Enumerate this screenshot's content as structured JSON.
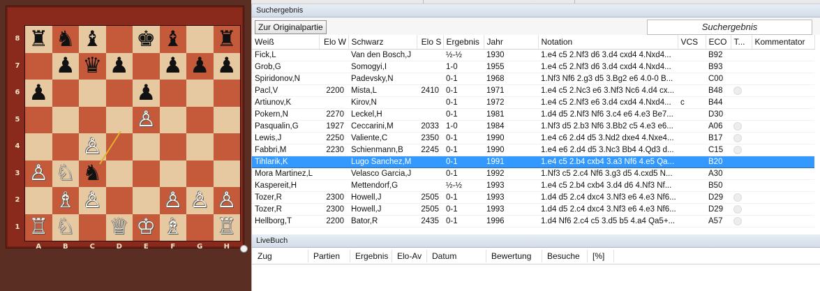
{
  "board": {
    "ranks": [
      "8",
      "7",
      "6",
      "5",
      "4",
      "3",
      "2",
      "1"
    ],
    "files": [
      "A",
      "B",
      "C",
      "D",
      "E",
      "F",
      "G",
      "H"
    ],
    "position": [
      [
        "bR",
        "bN",
        "bB",
        "",
        "bK",
        "bB",
        "",
        "bR"
      ],
      [
        "",
        "bP",
        "bQ",
        "bP",
        "",
        "bP",
        "bP",
        "bP"
      ],
      [
        "bP",
        "",
        "",
        "",
        "bP",
        "",
        "",
        ""
      ],
      [
        "",
        "",
        "",
        "",
        "wP",
        "",
        "",
        ""
      ],
      [
        "",
        "",
        "wP",
        "",
        "",
        "",
        "",
        ""
      ],
      [
        "wP",
        "wN",
        "bN",
        "",
        "",
        "",
        "",
        ""
      ],
      [
        "",
        "wB",
        "wP",
        "",
        "",
        "wP",
        "wP",
        "wP"
      ],
      [
        "wR",
        "wN",
        "",
        "wQ",
        "wK",
        "wB",
        "",
        "wR"
      ]
    ],
    "pieces": {
      "wK": "♔",
      "wQ": "♕",
      "wR": "♖",
      "wB": "♗",
      "wN": "♘",
      "wP": "♙",
      "bK": "♚",
      "bQ": "♛",
      "bR": "♜",
      "bB": "♝",
      "bN": "♞",
      "bP": "♟"
    },
    "last_move": "b4-c3"
  },
  "results_panel": {
    "header": "Suchergebnis",
    "original_button": "Zur Originalpartie",
    "title_box": "Suchergebnis",
    "columns": [
      "Weiß",
      "Elo W",
      "Schwarz",
      "Elo S",
      "Ergebnis",
      "Jahr",
      "Notation",
      "VCS",
      "ECO",
      "T...",
      "Kommentator"
    ],
    "rows": [
      {
        "white": "Fick,L",
        "elo_w": "",
        "black": "Van den Bosch,J",
        "elo_s": "",
        "result": "½-½",
        "year": "1930",
        "notation": "1.e4 c5 2.Nf3 d6 3.d4 cxd4 4.Nxd4...",
        "vcs": "",
        "eco": "B92",
        "t": ""
      },
      {
        "white": "Grob,G",
        "elo_w": "",
        "black": "Somogyi,I",
        "elo_s": "",
        "result": "1-0",
        "year": "1955",
        "notation": "1.e4 c5 2.Nf3 d6 3.d4 cxd4 4.Nxd4...",
        "vcs": "",
        "eco": "B93",
        "t": ""
      },
      {
        "white": "Spiridonov,N",
        "elo_w": "",
        "black": "Padevsky,N",
        "elo_s": "",
        "result": "0-1",
        "year": "1968",
        "notation": "1.Nf3 Nf6 2.g3 d5 3.Bg2 e6 4.0-0 B...",
        "vcs": "",
        "eco": "C00",
        "t": ""
      },
      {
        "white": "Pacl,V",
        "elo_w": "2200",
        "black": "Mista,L",
        "elo_s": "2410",
        "result": "0-1",
        "year": "1971",
        "notation": "1.e4 c5 2.Nc3 e6 3.Nf3 Nc6 4.d4 cx...",
        "vcs": "",
        "eco": "B48",
        "t": "dot"
      },
      {
        "white": "Artiunov,K",
        "elo_w": "",
        "black": "Kirov,N",
        "elo_s": "",
        "result": "0-1",
        "year": "1972",
        "notation": "1.e4 c5 2.Nf3 e6 3.d4 cxd4 4.Nxd4...",
        "vcs": "c",
        "eco": "B44",
        "t": ""
      },
      {
        "white": "Pokern,N",
        "elo_w": "2270",
        "black": "Leckel,H",
        "elo_s": "",
        "result": "0-1",
        "year": "1981",
        "notation": "1.d4 d5 2.Nf3 Nf6 3.c4 e6 4.e3 Be7...",
        "vcs": "",
        "eco": "D30",
        "t": ""
      },
      {
        "white": "Pasqualin,G",
        "elo_w": "1927",
        "black": "Ceccarini,M",
        "elo_s": "2033",
        "result": "1-0",
        "year": "1984",
        "notation": "1.Nf3 d5 2.b3 Nf6 3.Bb2 c5 4.e3 e6...",
        "vcs": "",
        "eco": "A06",
        "t": "dot"
      },
      {
        "white": "Lewis,J",
        "elo_w": "2250",
        "black": "Valiente,C",
        "elo_s": "2350",
        "result": "0-1",
        "year": "1990",
        "notation": "1.e4 c6 2.d4 d5 3.Nd2 dxe4 4.Nxe4...",
        "vcs": "",
        "eco": "B17",
        "t": "dot"
      },
      {
        "white": "Fabbri,M",
        "elo_w": "2230",
        "black": "Schienmann,B",
        "elo_s": "2245",
        "result": "0-1",
        "year": "1990",
        "notation": "1.e4 e6 2.d4 d5 3.Nc3 Bb4 4.Qd3 d...",
        "vcs": "",
        "eco": "C15",
        "t": "dot"
      },
      {
        "white": "Tihlarik,K",
        "elo_w": "",
        "black": "Lugo Sanchez,M",
        "elo_s": "",
        "result": "0-1",
        "year": "1991",
        "notation": "1.e4 c5 2.b4 cxb4 3.a3 Nf6 4.e5 Qa...",
        "vcs": "",
        "eco": "B20",
        "t": "",
        "selected": true
      },
      {
        "white": "Mora Martinez,L",
        "elo_w": "",
        "black": "Velasco Garcia,J",
        "elo_s": "",
        "result": "0-1",
        "year": "1992",
        "notation": "1.Nf3 c5 2.c4 Nf6 3.g3 d5 4.cxd5 N...",
        "vcs": "",
        "eco": "A30",
        "t": ""
      },
      {
        "white": "Kaspereit,H",
        "elo_w": "",
        "black": "Mettendorf,G",
        "elo_s": "",
        "result": "½-½",
        "year": "1993",
        "notation": "1.e4 c5 2.b4 cxb4 3.d4 d6 4.Nf3 Nf...",
        "vcs": "",
        "eco": "B50",
        "t": ""
      },
      {
        "white": "Tozer,R",
        "elo_w": "2300",
        "black": "Howell,J",
        "elo_s": "2505",
        "result": "0-1",
        "year": "1993",
        "notation": "1.d4 d5 2.c4 dxc4 3.Nf3 e6 4.e3 Nf6...",
        "vcs": "",
        "eco": "D29",
        "t": "dot"
      },
      {
        "white": "Tozer,R",
        "elo_w": "2300",
        "black": "Howell,J",
        "elo_s": "2505",
        "result": "0-1",
        "year": "1993",
        "notation": "1.d4 d5 2.c4 dxc4 3.Nf3 e6 4.e3 Nf6...",
        "vcs": "",
        "eco": "D29",
        "t": "dot"
      },
      {
        "white": "Hellborg,T",
        "elo_w": "2200",
        "black": "Bator,R",
        "elo_s": "2435",
        "result": "0-1",
        "year": "1996",
        "notation": "1.d4 Nf6 2.c4 c5 3.d5 b5 4.a4 Qa5+...",
        "vcs": "",
        "eco": "A57",
        "t": "dot"
      }
    ]
  },
  "livebook": {
    "header": "LiveBuch",
    "columns": [
      "Zug",
      "Partien",
      "Ergebnis",
      "Elo-Av",
      "Datum",
      "Bewertung",
      "Besuche",
      "[%]"
    ]
  },
  "colors": {
    "selection": "#3399ff",
    "board_light": "#e7c9a1",
    "board_dark": "#c55a3b",
    "frame": "#8a2a1c"
  }
}
